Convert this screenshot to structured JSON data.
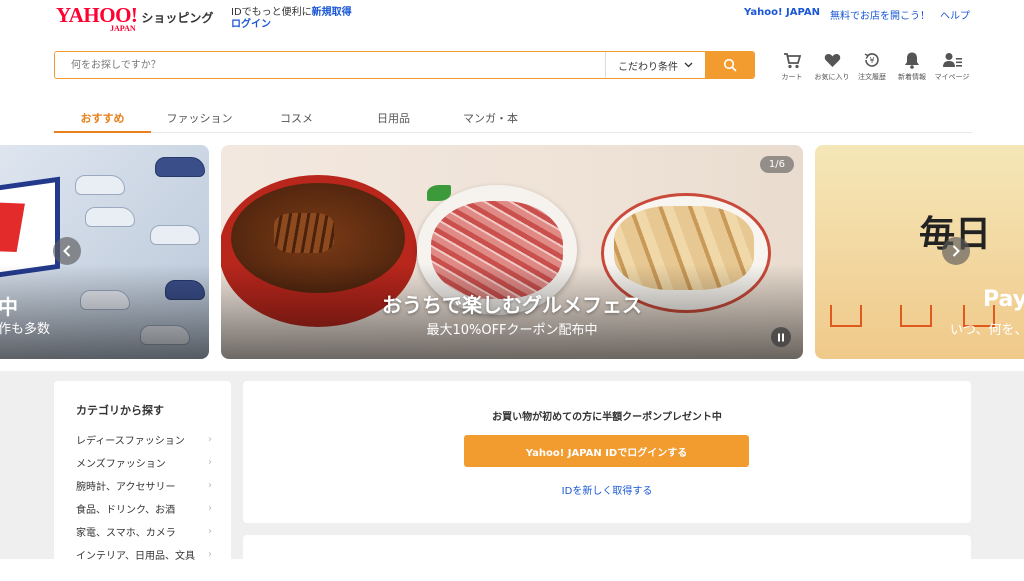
{
  "header": {
    "logo": "YAHOO!",
    "logo_sub": "JAPAN",
    "logo_service": "ショッピング",
    "login_prompt": "IDでもっと便利に",
    "register_link": "新規取得",
    "login_link": "ログイン",
    "right_links": [
      "Yahoo! JAPAN",
      "無料でお店を開こう！",
      "ヘルプ"
    ]
  },
  "search": {
    "placeholder": "何をお探しですか？",
    "filter_label": "こだわり条件"
  },
  "utilities": [
    {
      "label": "カート",
      "icon": "cart-icon"
    },
    {
      "label": "お気に入り",
      "icon": "heart-icon"
    },
    {
      "label": "注文履歴",
      "icon": "order-history-icon"
    },
    {
      "label": "新着情報",
      "icon": "bell-icon"
    },
    {
      "label": "マイページ",
      "icon": "user-icon"
    }
  ],
  "tabs": [
    "おすすめ",
    "ファッション",
    "コスメ",
    "日用品",
    "マンガ・本"
  ],
  "carousel": {
    "main_title": "おうちで楽しむグルメフェス",
    "main_subtitle": "最大10%OFFクーポン配布中",
    "counter": "1/6",
    "left_text_1": "中",
    "left_text_2": "作も多数",
    "right_text_1": "毎日",
    "right_text_2": "Pay",
    "right_text_3": "いつ、何を、"
  },
  "categories": {
    "title": "カテゴリから探す",
    "items": [
      "レディースファッション",
      "メンズファッション",
      "腕時計、アクセサリー",
      "食品、ドリンク、お酒",
      "家電、スマホ、カメラ",
      "インテリア、日用品、文具"
    ]
  },
  "login_card": {
    "message": "お買い物が初めての方に半額クーポンプレゼント中",
    "button": "Yahoo! JAPAN IDでログインする",
    "new_id": "IDを新しく取得する"
  },
  "colors": {
    "accent": "#f29b2f",
    "brand": "#ff0033",
    "link": "#1a57d6"
  }
}
